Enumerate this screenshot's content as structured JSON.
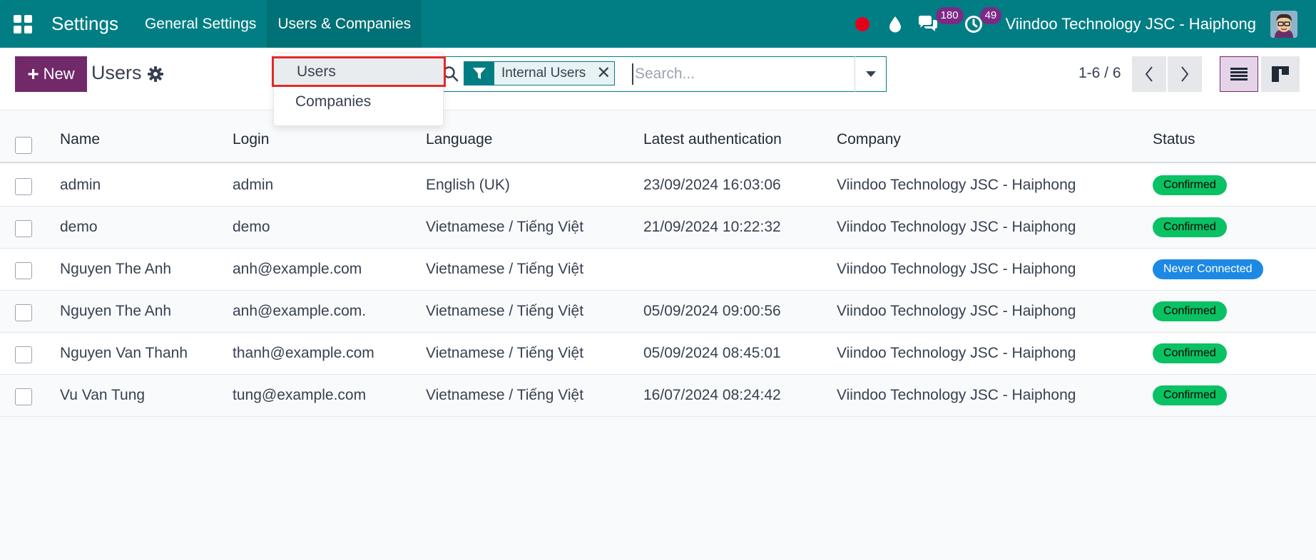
{
  "navbar": {
    "app_title": "Settings",
    "menu": [
      "General Settings",
      "Users & Companies"
    ],
    "chat_count": "180",
    "activity_count": "49",
    "company": "Viindoo Technology JSC - Haiphong",
    "colors": {
      "bar": "#017e84",
      "badge": "#7c2a85",
      "record": "#e3001b"
    }
  },
  "control_panel": {
    "new_label": "New",
    "title": "Users",
    "facet_label": "Internal Users",
    "search_placeholder": "Search...",
    "pager": "1-6 / 6",
    "accent": "#71296a"
  },
  "dropdown": {
    "items": [
      "Users",
      "Companies"
    ],
    "highlight_color": "#e22a27"
  },
  "table": {
    "columns": [
      "Name",
      "Login",
      "Language",
      "Latest authentication",
      "Company",
      "Status"
    ],
    "rows": [
      {
        "name": "admin",
        "login": "admin",
        "language": "English (UK)",
        "auth": "23/09/2024 16:03:06",
        "company": "Viindoo Technology JSC - Haiphong",
        "status": "Confirmed",
        "status_type": "confirmed"
      },
      {
        "name": "demo",
        "login": "demo",
        "language": "Vietnamese / Tiếng Việt",
        "auth": "21/09/2024 10:22:32",
        "company": "Viindoo Technology JSC - Haiphong",
        "status": "Confirmed",
        "status_type": "confirmed"
      },
      {
        "name": "Nguyen The Anh",
        "login": "anh@example.com",
        "language": "Vietnamese / Tiếng Việt",
        "auth": "",
        "company": "Viindoo Technology JSC - Haiphong",
        "status": "Never Connected",
        "status_type": "never"
      },
      {
        "name": "Nguyen The Anh",
        "login": "anh@example.com.",
        "language": "Vietnamese / Tiếng Việt",
        "auth": "05/09/2024 09:00:56",
        "company": "Viindoo Technology JSC - Haiphong",
        "status": "Confirmed",
        "status_type": "confirmed"
      },
      {
        "name": "Nguyen Van Thanh",
        "login": "thanh@example.com",
        "language": "Vietnamese / Tiếng Việt",
        "auth": "05/09/2024 08:45:01",
        "company": "Viindoo Technology JSC - Haiphong",
        "status": "Confirmed",
        "status_type": "confirmed"
      },
      {
        "name": "Vu Van Tung",
        "login": "tung@example.com",
        "language": "Vietnamese / Tiếng Việt",
        "auth": "16/07/2024 08:24:42",
        "company": "Viindoo Technology JSC - Haiphong",
        "status": "Confirmed",
        "status_type": "confirmed"
      }
    ],
    "status_colors": {
      "confirmed": "#0ac164",
      "never": "#1e88e5"
    }
  }
}
